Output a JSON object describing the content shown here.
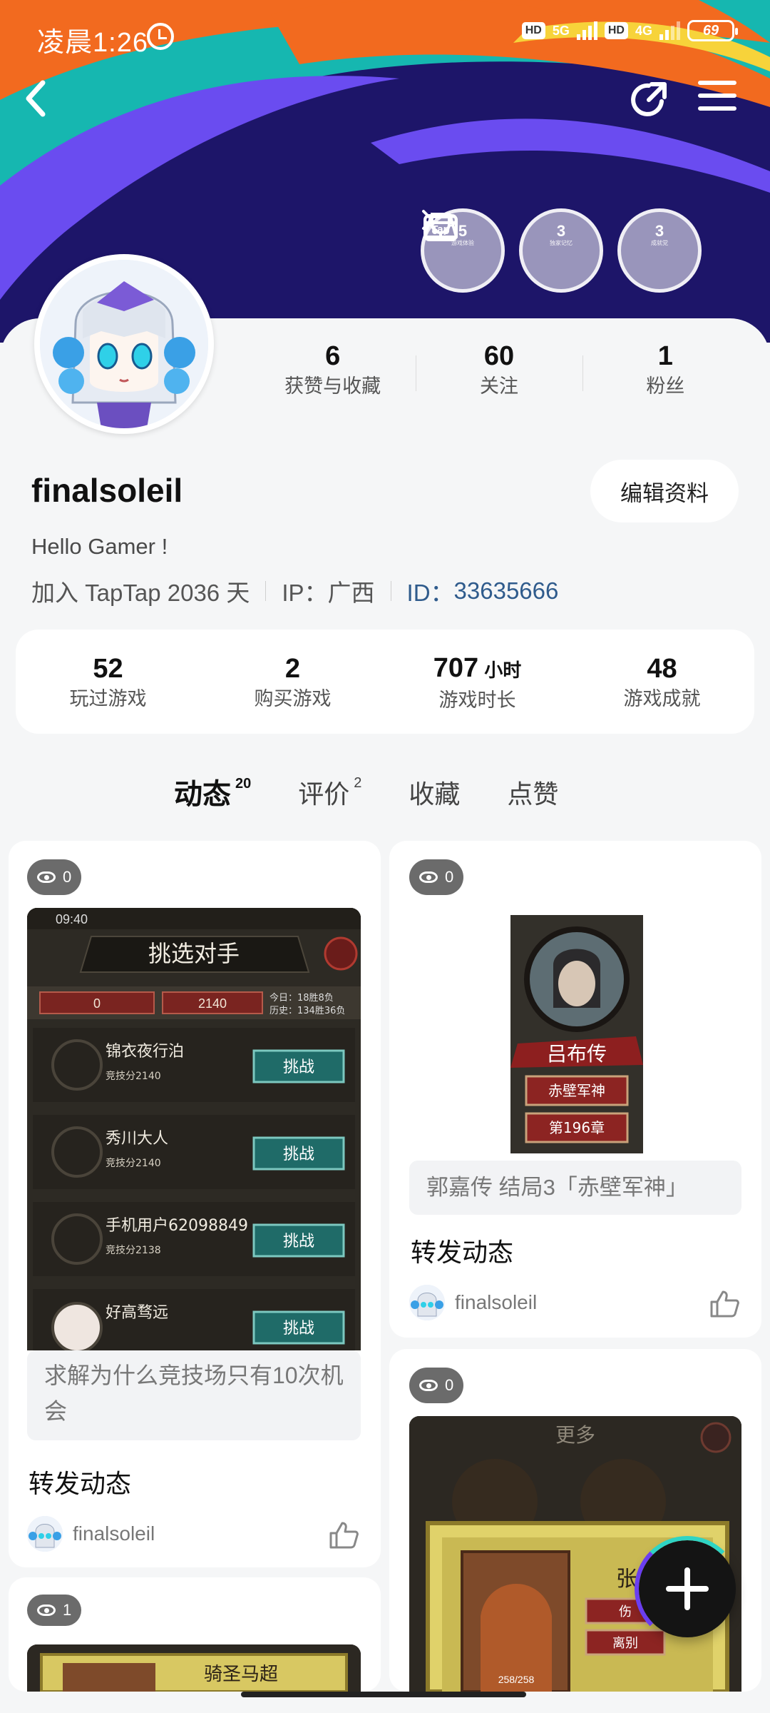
{
  "status_bar": {
    "time": "凌晨1:26",
    "network_left": "5G",
    "network_right": "4G",
    "hd": "HD",
    "battery": "69"
  },
  "header": {
    "badges": [
      {
        "count": "5",
        "sub": "游戏体验"
      },
      {
        "count": "3",
        "sub": "独家记忆"
      },
      {
        "count": "3",
        "sub": "成就党"
      }
    ],
    "badge_tap_text": "Tap"
  },
  "profile": {
    "counts": [
      {
        "value": "6",
        "label": "获赞与收藏"
      },
      {
        "value": "60",
        "label": "关注"
      },
      {
        "value": "1",
        "label": "粉丝"
      }
    ],
    "username": "finalsoleil",
    "edit_button": "编辑资料",
    "bio": "Hello Gamer !",
    "joined": "加入 TapTap 2036 天",
    "ip": "IP：广西",
    "id_label": "ID：",
    "id_value": "33635666"
  },
  "stats": [
    {
      "value": "52",
      "unit": "",
      "label": "玩过游戏"
    },
    {
      "value": "2",
      "unit": "",
      "label": "购买游戏"
    },
    {
      "value": "707",
      "unit": "小时",
      "label": "游戏时长"
    },
    {
      "value": "48",
      "unit": "",
      "label": "游戏成就"
    }
  ],
  "tabs": [
    {
      "label": "动态",
      "count": "20",
      "active": true
    },
    {
      "label": "评价",
      "count": "2",
      "active": false
    },
    {
      "label": "收藏",
      "count": "",
      "active": false
    },
    {
      "label": "点赞",
      "count": "",
      "active": false
    }
  ],
  "feed": [
    {
      "views": "0",
      "screenshot": {
        "time": "09:40",
        "title": "挑选对手",
        "score_left": "0",
        "score_right": "2140",
        "today": "今日：18胜8负",
        "history": "历史：134胜36负",
        "challenge": "挑战",
        "opponents": [
          {
            "name": "锦衣夜行泊",
            "score": "竞技分2140"
          },
          {
            "name": "秀川大人",
            "score": "竞技分2140"
          },
          {
            "name": "手机用户62098849",
            "score": "竞技分2138"
          },
          {
            "name": "好高骛远",
            "score": ""
          }
        ]
      },
      "caption": "求解为什么竞技场只有10次机会",
      "title": "转发动态",
      "author": "finalsoleil"
    },
    {
      "views": "0",
      "screenshot": {
        "name": "吕布传",
        "sub1": "赤壁军神",
        "sub2": "第196章"
      },
      "caption": "郭嘉传 结局3「赤壁军神」",
      "title": "转发动态",
      "author": "finalsoleil"
    },
    {
      "views": "0",
      "screenshot": {
        "header": "更多",
        "name": "张角",
        "hp": "258/258",
        "opt1": "伤",
        "opt2": "离别"
      }
    },
    {
      "views": "1",
      "screenshot": {
        "title": "骑圣马超"
      }
    }
  ],
  "colors": {
    "accent": "#19c7b7",
    "id_blue": "#2f5b8c",
    "banner_base": "#1d1569",
    "banner_orange": "#f26a1f",
    "banner_teal": "#16b7b0",
    "banner_purple": "#6a4cf0"
  },
  "icons": {
    "back": "chevron-left-icon",
    "share": "share-icon",
    "menu": "hamburger-menu-icon",
    "eye": "eye-icon",
    "like": "thumbs-up-icon",
    "fab": "plus-icon"
  }
}
